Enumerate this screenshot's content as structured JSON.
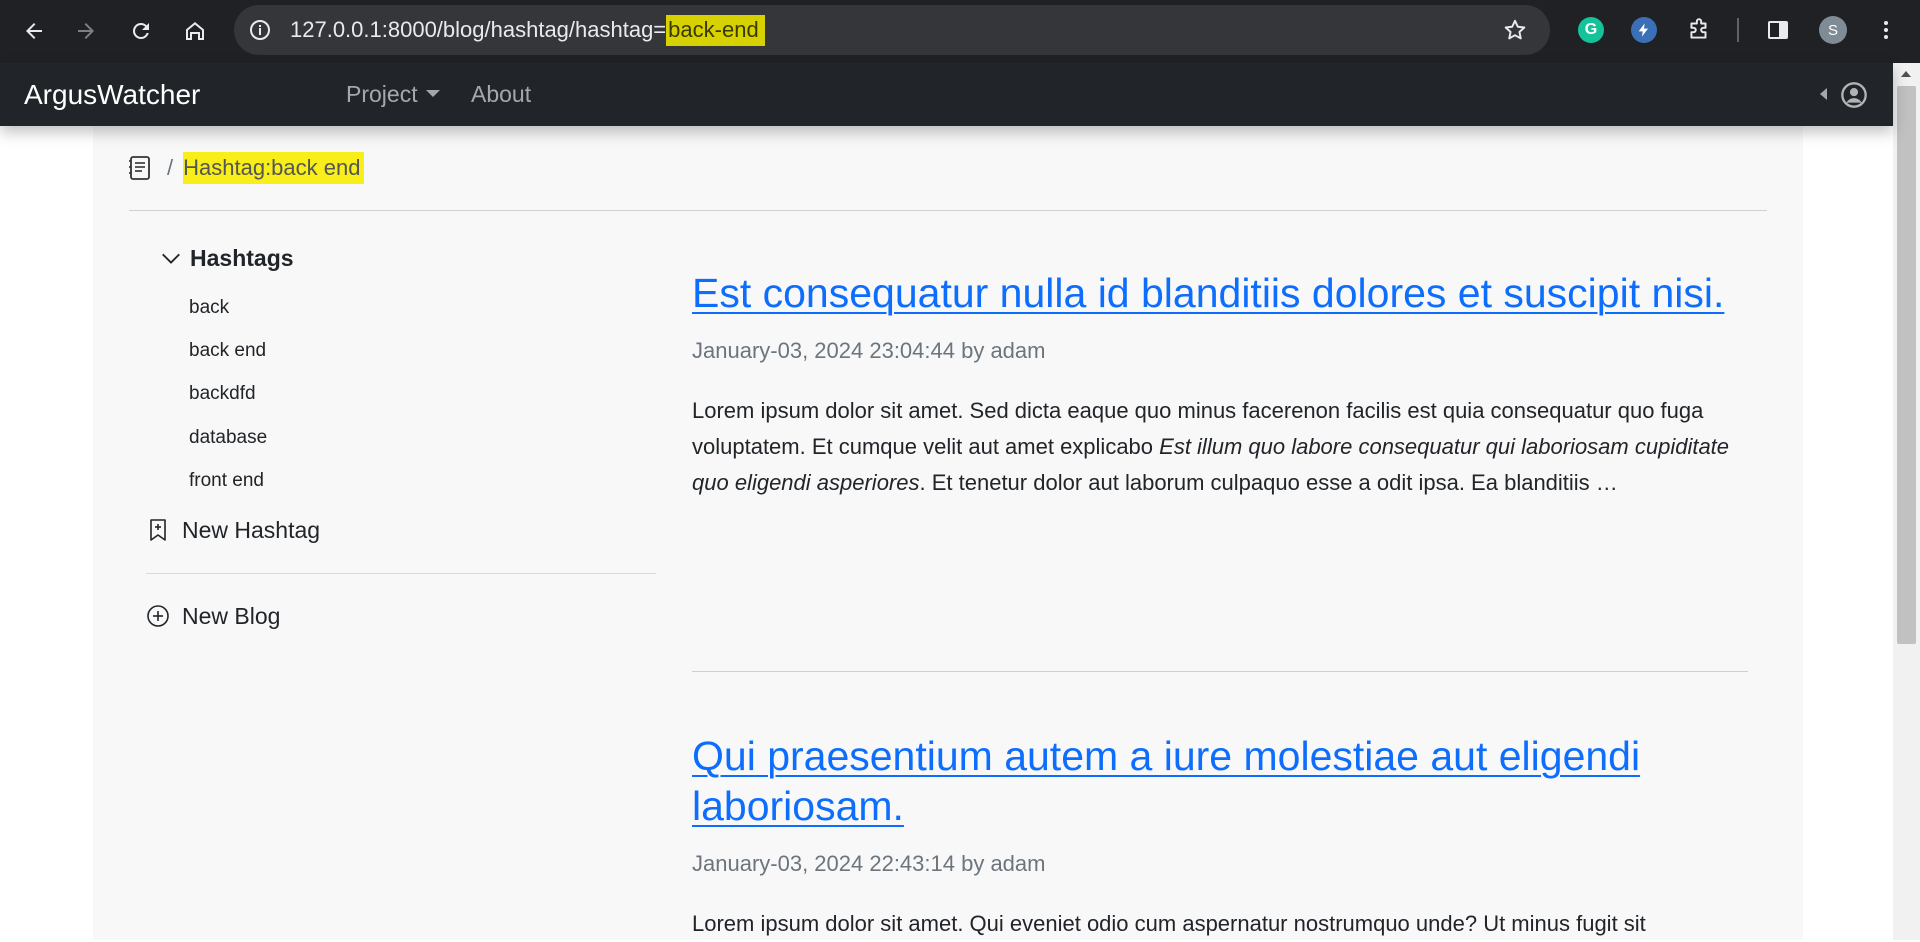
{
  "browser": {
    "url_prefix": "127.0.0.1:8000/blog/hashtag/hashtag=",
    "url_highlight": "back-end",
    "avatar_letter": "S",
    "grammarly_letter": "G"
  },
  "navbar": {
    "brand": "ArgusWatcher",
    "links": [
      "Project",
      "About"
    ]
  },
  "breadcrumb": {
    "current": "Hashtag:back end"
  },
  "sidebar": {
    "hashtags_title": "Hashtags",
    "tags": [
      "back",
      "back end",
      "backdfd",
      "database",
      "front end"
    ],
    "new_hashtag": "New Hashtag",
    "new_blog": "New Blog"
  },
  "posts": [
    {
      "title": "Est consequatur nulla id blanditiis dolores et suscipit nisi.",
      "meta": "January-03, 2024 23:04:44 by adam",
      "excerpt_before": "Lorem ipsum dolor sit amet. Sed dicta eaque quo minus facerenon facilis est quia consequatur quo fuga voluptatem. Et cumque velit aut amet explicabo ",
      "excerpt_italic": "Est illum quo labore consequatur qui laboriosam cupiditate quo eligendi asperiores",
      "excerpt_after": ". Et tenetur dolor aut laborum culpaquo esse a odit ipsa. Ea blanditiis …"
    },
    {
      "title": "Qui praesentium autem a iure molestiae aut eligendi laboriosam.",
      "meta": "January-03, 2024 22:43:14 by adam",
      "excerpt_before": "Lorem ipsum dolor sit amet. Qui eveniet odio cum aspernatur nostrumquo unde? Ut minus fugit sit",
      "excerpt_italic": "",
      "excerpt_after": ""
    }
  ],
  "colors": {
    "link": "#0d6efd",
    "highlight": "#f7ee1a",
    "navbar": "#212529"
  }
}
